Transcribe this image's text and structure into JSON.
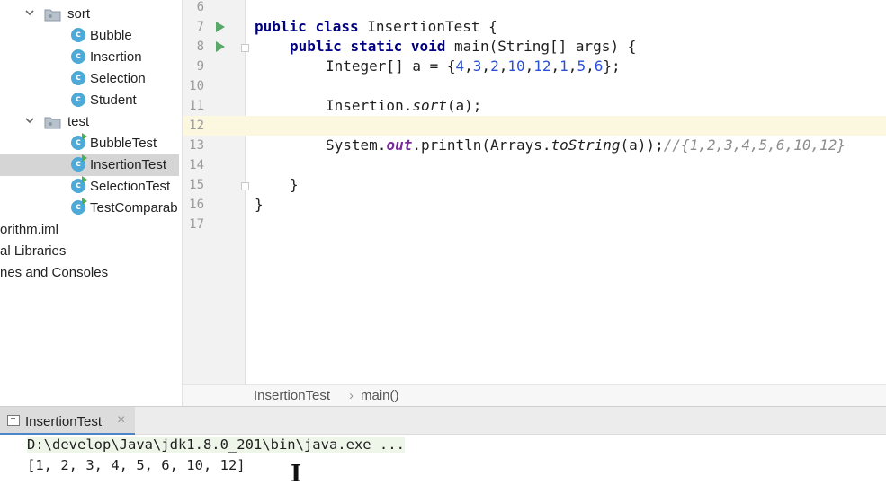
{
  "project_tree": {
    "rows": [
      {
        "label": "sort",
        "type": "folder"
      },
      {
        "label": "Bubble",
        "type": "class"
      },
      {
        "label": "Insertion",
        "type": "class"
      },
      {
        "label": "Selection",
        "type": "class"
      },
      {
        "label": "Student",
        "type": "class"
      },
      {
        "label": "test",
        "type": "folder"
      },
      {
        "label": "BubbleTest",
        "type": "runnable-class"
      },
      {
        "label": "InsertionTest",
        "type": "runnable-class",
        "selected": true
      },
      {
        "label": "SelectionTest",
        "type": "runnable-class"
      },
      {
        "label": "TestComparab",
        "type": "runnable-class"
      },
      {
        "label": "orithm.iml",
        "type": "file"
      },
      {
        "label": "al Libraries",
        "type": "node"
      },
      {
        "label": "nes and Consoles",
        "type": "node"
      }
    ],
    "class_icon_letter": "c"
  },
  "editor": {
    "line_numbers": [
      "6",
      "7",
      "8",
      "9",
      "10",
      "11",
      "12",
      "13",
      "14",
      "15",
      "16",
      "17"
    ],
    "current_line": "12",
    "code": {
      "l7_kw1": "public",
      "l7_kw2": "class",
      "l7_rest": "InsertionTest {",
      "l8_kw1": "public",
      "l8_kw2": "static",
      "l8_kw3": "void",
      "l8_rest": "main(String[] args) {",
      "l9_pre": "Integer[] a = {",
      "l9_nums": [
        "4",
        "3",
        "2",
        "10",
        "12",
        "1",
        "5",
        "6"
      ],
      "l9_post": "};",
      "l11_pre": "Insertion.",
      "l11_call": "sort",
      "l11_post": "(a);",
      "l13_pre": "System.",
      "l13_field": "out",
      "l13_mid": ".println(Arrays.",
      "l13_call": "toString",
      "l13_post": "(a));",
      "l13_comment": "//{1,2,3,4,5,6,10,12}",
      "l15": "}",
      "l16": "}"
    }
  },
  "breadcrumb": {
    "class_name": "InsertionTest",
    "separator": "›",
    "method": "main()"
  },
  "run_panel": {
    "tab_label": "InsertionTest",
    "tab_close": "×",
    "command": "D:\\develop\\Java\\jdk1.8.0_201\\bin\\java.exe ...",
    "output": "[1, 2, 3, 4, 5, 6, 10, 12]"
  },
  "colors": {
    "keyword": "#000080",
    "number": "#2a4fd8",
    "comment": "#8c8c8c",
    "static_field": "#7a2b9a",
    "run_icon": "#59a869",
    "class_icon": "#4ca9d8",
    "current_line_bg": "#fcf8e0"
  },
  "cursor_glyph": "I"
}
